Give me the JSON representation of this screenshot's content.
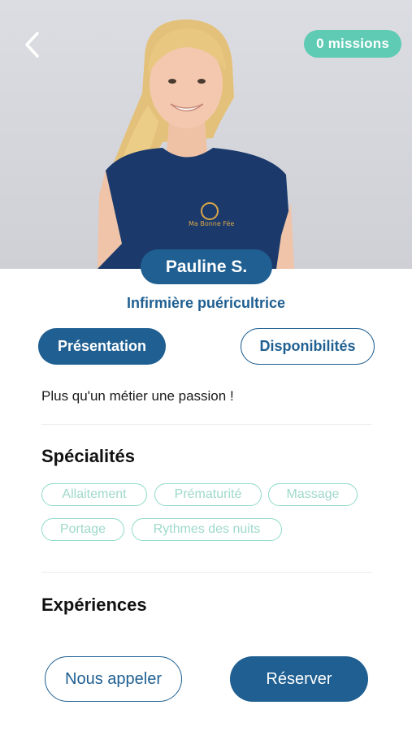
{
  "header": {
    "missions_badge": "0 missions",
    "back_icon": "chevron-left-icon"
  },
  "profile": {
    "name": "Pauline S.",
    "role": "Infirmière puéricultrice",
    "shirt_logo": "Ma Bonne Fée"
  },
  "tabs": [
    {
      "label": "Présentation",
      "active": true
    },
    {
      "label": "Disponibilités",
      "active": false
    }
  ],
  "presentation": {
    "text": "Plus qu'un métier une passion !"
  },
  "specialties": {
    "title": "Spécialités",
    "items": [
      "Allaitement",
      "Prématurité",
      "Massage",
      "Portage",
      "Rythmes des nuits"
    ]
  },
  "experiences": {
    "title": "Expériences"
  },
  "actions": {
    "call_label": "Nous appeler",
    "book_label": "Réserver"
  },
  "colors": {
    "primary": "#1f5f91",
    "accent": "#5fcbb4",
    "chip_border": "#8fdbc9"
  }
}
